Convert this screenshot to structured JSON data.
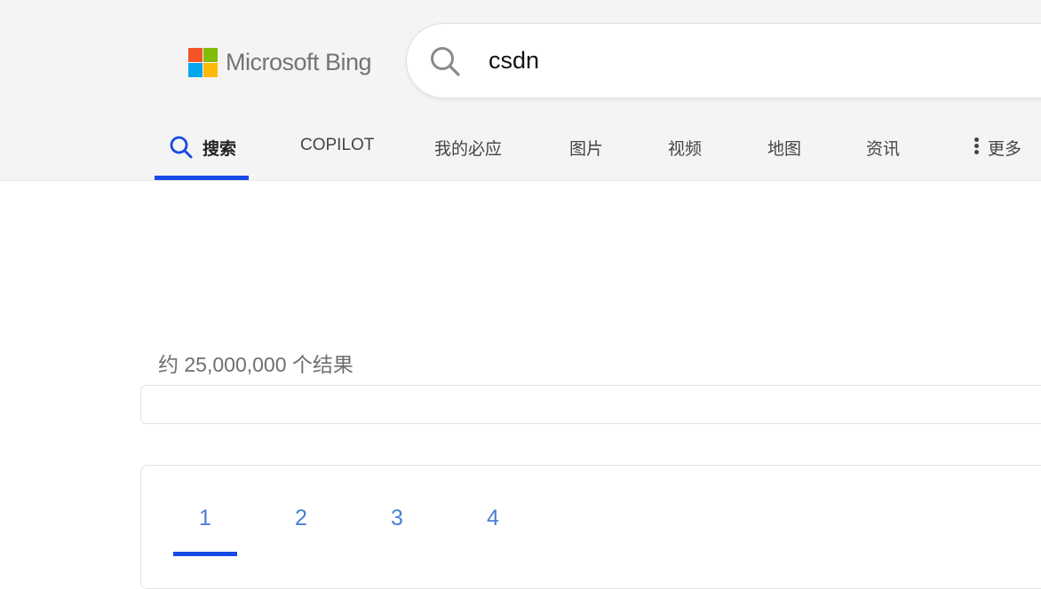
{
  "brand": {
    "logo_text": "Microsoft Bing",
    "square_colors": [
      "#f35325",
      "#81bc06",
      "#05a6f0",
      "#ffba08"
    ]
  },
  "search": {
    "query": "csdn",
    "icon": "search-icon"
  },
  "nav": {
    "items": [
      {
        "label": "搜索",
        "icon": "search-icon",
        "active": true
      },
      {
        "label": "COPILOT"
      },
      {
        "label": "我的必应"
      },
      {
        "label": "图片"
      },
      {
        "label": "视频"
      },
      {
        "label": "地图"
      },
      {
        "label": "资讯"
      },
      {
        "label": "更多",
        "icon": "more-vertical-icon"
      }
    ],
    "accent_color": "#174ae4"
  },
  "results": {
    "count_text": "约 25,000,000 个结果"
  },
  "pagination": {
    "pages": [
      "1",
      "2",
      "3",
      "4"
    ],
    "current": "1",
    "link_color": "#4a7fd4"
  }
}
